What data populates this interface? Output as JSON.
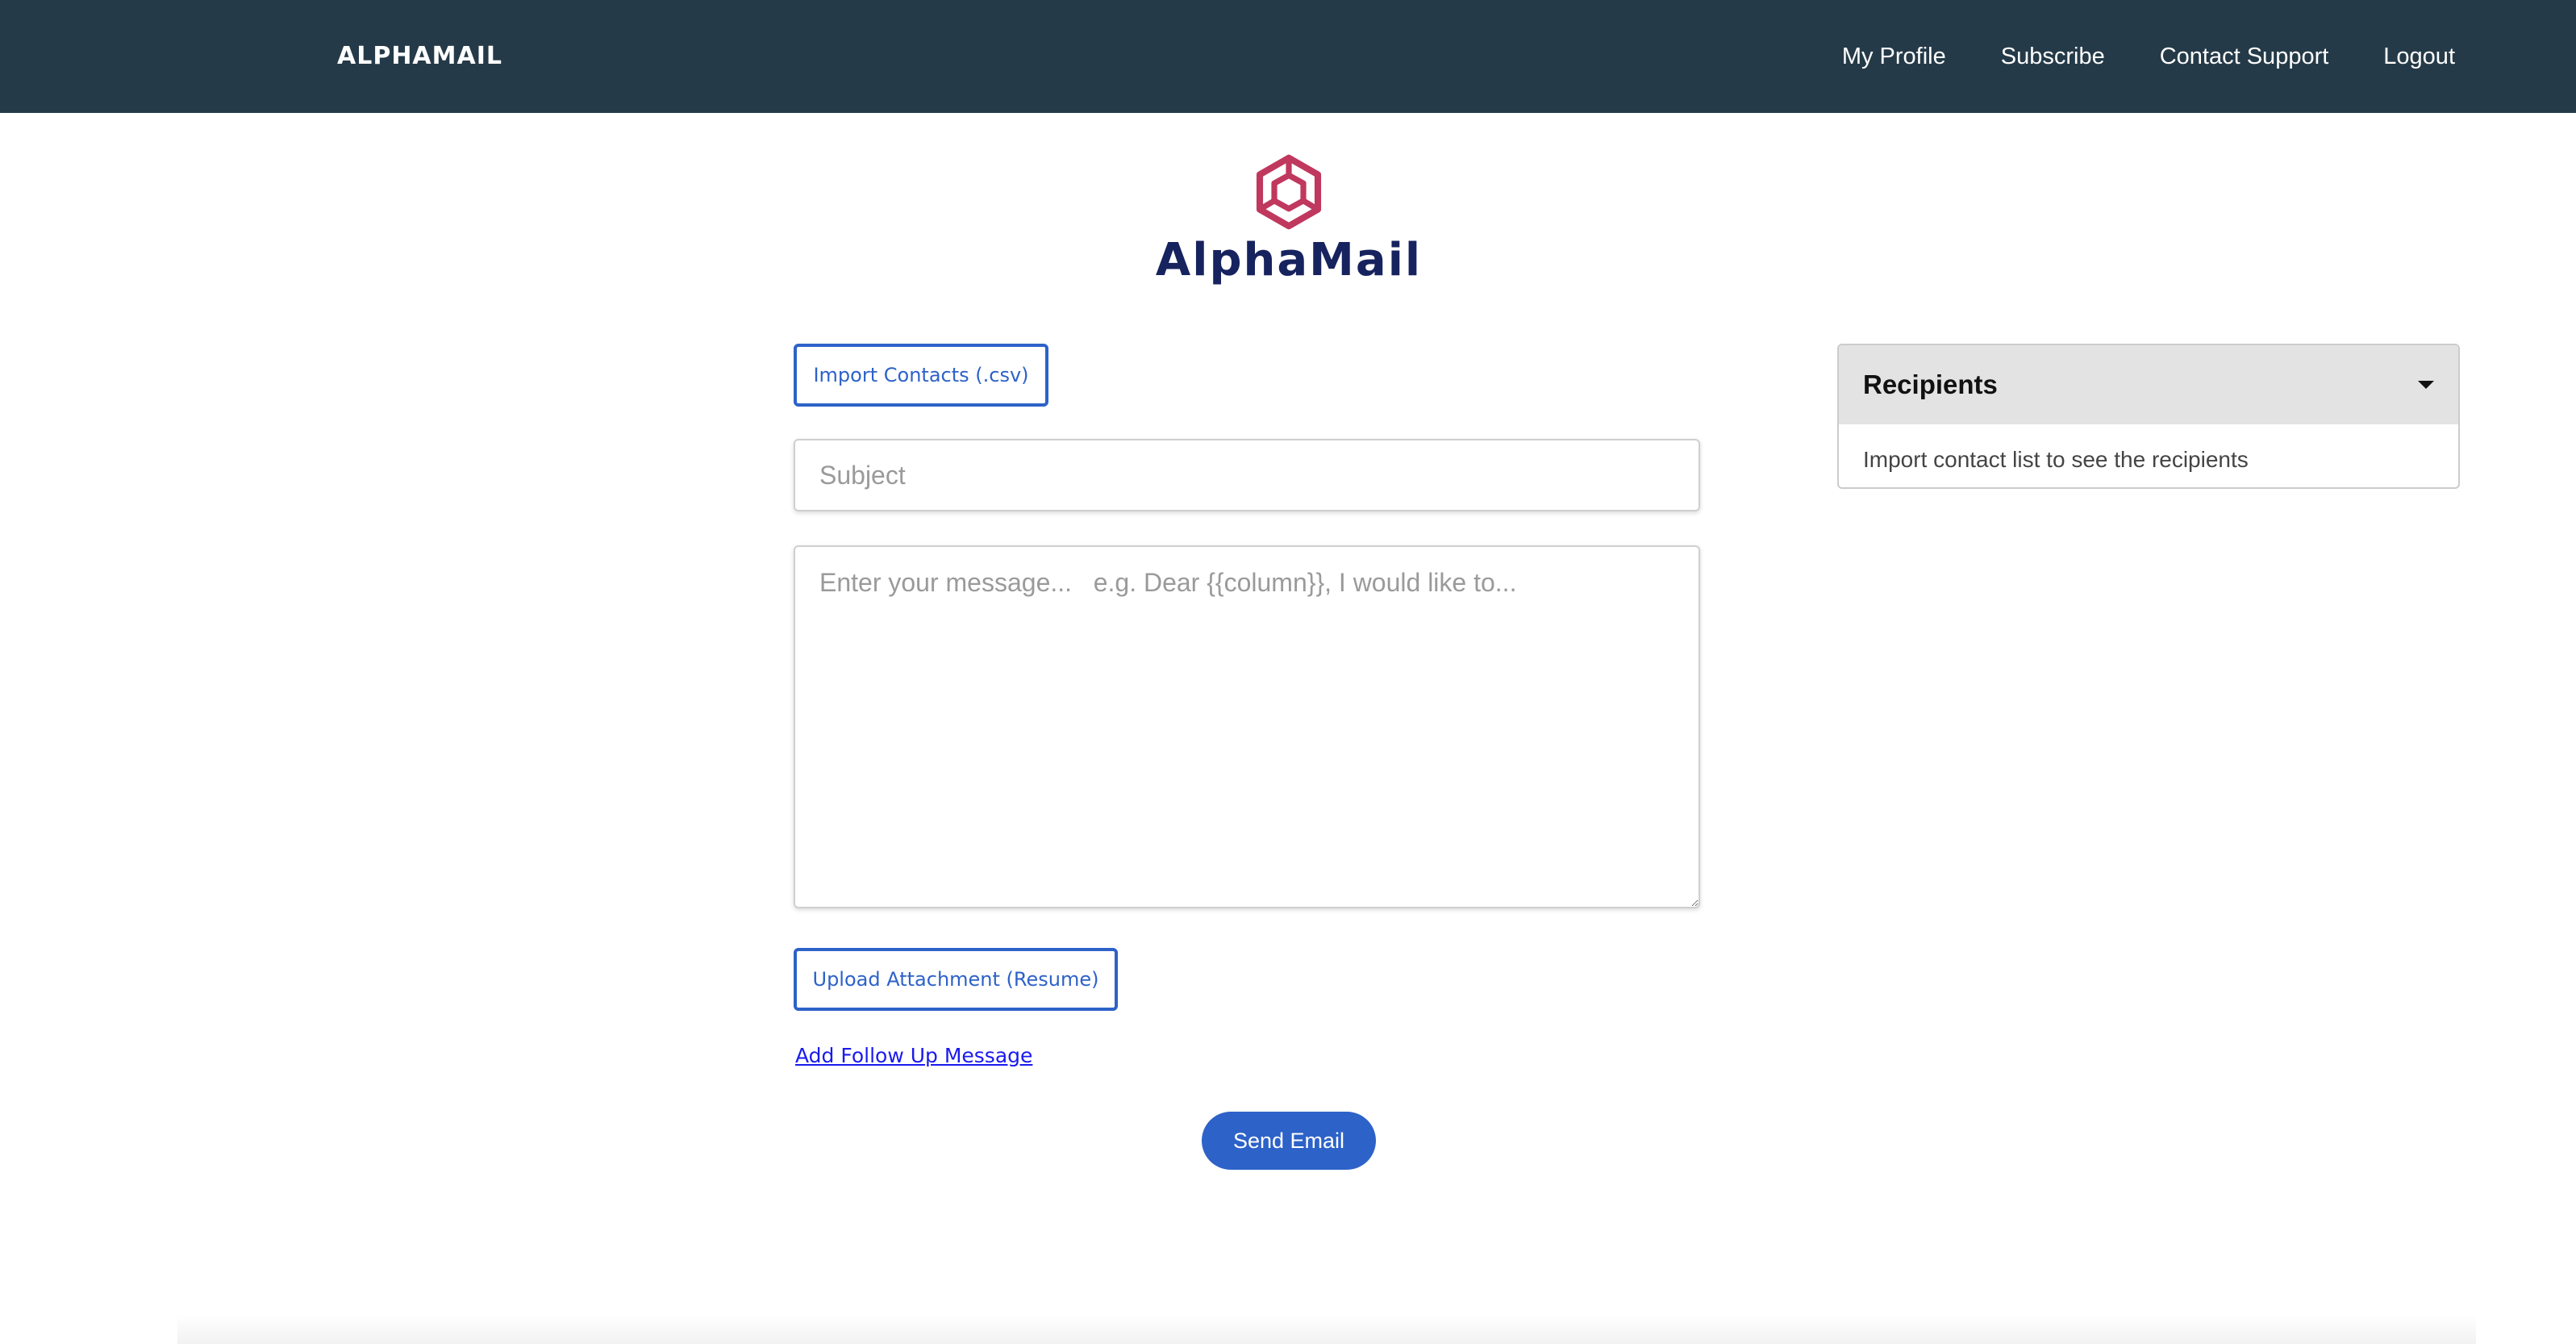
{
  "header": {
    "brand": "ALPHAMAIL",
    "nav": [
      {
        "label": "My Profile"
      },
      {
        "label": "Subscribe"
      },
      {
        "label": "Contact Support"
      },
      {
        "label": "Logout"
      }
    ],
    "background_color": "#253a48"
  },
  "logo": {
    "icon": "hexagon-cube-icon",
    "text": "AlphaMail",
    "icon_color": "#c0385e",
    "text_color": "#16235e"
  },
  "form": {
    "import_contacts_label": "Import Contacts (.csv)",
    "subject_placeholder": "Subject",
    "subject_value": "",
    "message_placeholder": "Enter your message...   e.g. Dear {{column}}, I would like to...",
    "message_value": "",
    "upload_attachment_label": "Upload Attachment (Resume)",
    "follow_up_link": "Add Follow Up Message",
    "send_label": "Send Email",
    "accent_color": "#2d62c8"
  },
  "recipients": {
    "title": "Recipients",
    "toggle_icon": "caret-down-icon",
    "empty_text": "Import contact list to see the recipients"
  }
}
